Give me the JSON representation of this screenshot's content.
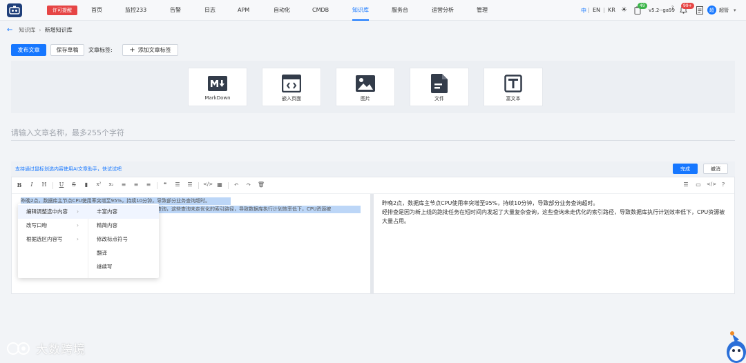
{
  "nav": {
    "license": "许可提醒",
    "items": [
      "首页",
      "监控233",
      "告警",
      "日志",
      "APM",
      "自动化",
      "CMDB",
      "知识库",
      "服务台",
      "运营分析",
      "管理"
    ],
    "active": "知识库",
    "langs": [
      "中",
      "EN",
      "KR"
    ],
    "badge_green": "49",
    "version": "v5.2--ga99",
    "badge_red": "99+",
    "avatar": "超",
    "user": "超管"
  },
  "breadcrumb": {
    "root": "知识库",
    "current": "新增知识库"
  },
  "toolbar": {
    "publish": "发布文章",
    "save_draft": "保存草稿",
    "tag_label": "文章标签:",
    "add_tag": "添加文章标签"
  },
  "types": [
    {
      "label": "MarkDown",
      "icon": "markdown-icon"
    },
    {
      "label": "嵌入页面",
      "icon": "embed-page-icon"
    },
    {
      "label": "图片",
      "icon": "image-icon"
    },
    {
      "label": "文件",
      "icon": "file-icon"
    },
    {
      "label": "富文本",
      "icon": "rich-text-icon"
    }
  ],
  "title_placeholder": "请输入文章名称，最多255个字符",
  "ai": {
    "tip": "支持通过鼠标划选内容使用AI文章助手，快试试吧",
    "done": "完成",
    "cancel": "撤消"
  },
  "editor": {
    "left_line1": "昨晚2点，数据库主节点CPU使用率突增至95%，持续10分钟，导致部分业务查询超时。",
    "left_line2": "杂查询，这些查询未走优化的索引路径，导致数据库执行计划效率低下，CPU资源被",
    "right_p1": "昨晚2点，数据库主节点CPU使用率突增至95%，持续10分钟，导致部分业务查询超时。",
    "right_p2": "经排查是因为新上线的跑批任务在短时间内发起了大量复杂查询，这些查询未走优化的索引路径，导致数据库执行计划效率低下，CPU资源被大量占用。"
  },
  "menu": {
    "main": [
      "编辑调整选中内容",
      "改写口吻",
      "根据选区内容写"
    ],
    "sub": [
      "丰富内容",
      "精简内容",
      "修改标点符号",
      "翻译",
      "继续写"
    ]
  },
  "watermark": "大数跨境"
}
